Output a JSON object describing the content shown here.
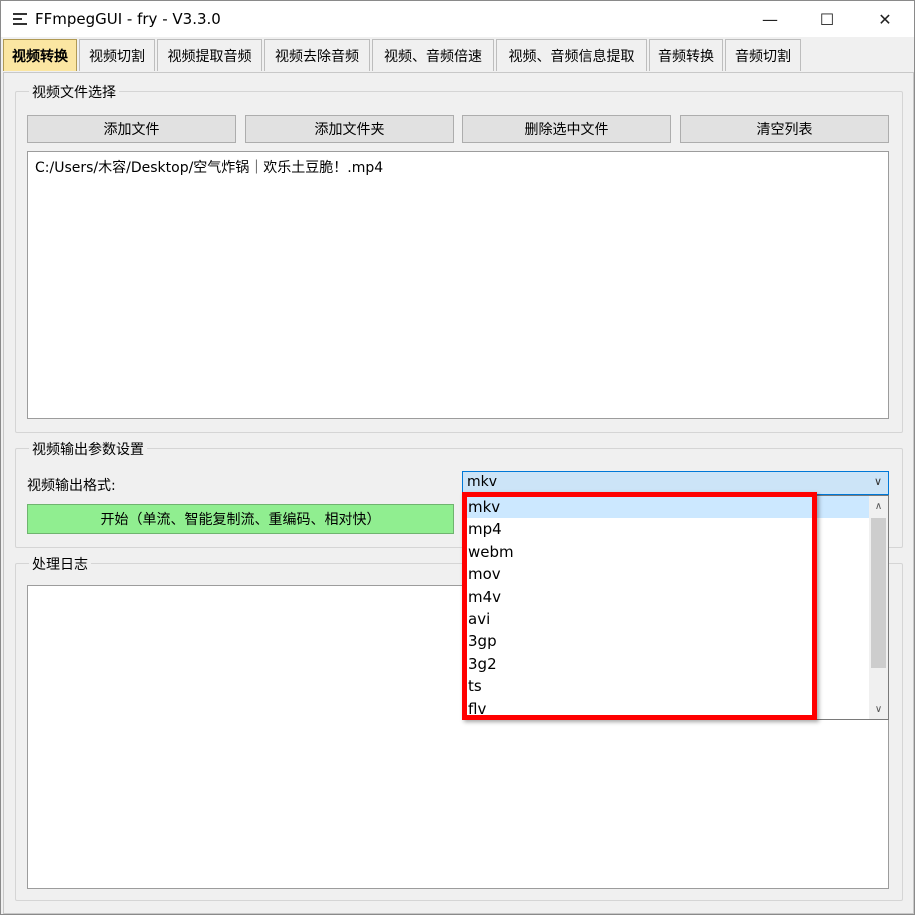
{
  "window": {
    "title": "FFmpegGUI - fry - V3.3.0",
    "minimize_glyph": "—",
    "maximize_glyph": "☐",
    "close_glyph": "✕"
  },
  "tabs": [
    {
      "label": "视频转换",
      "active": true
    },
    {
      "label": "视频切割"
    },
    {
      "label": "视频提取音频"
    },
    {
      "label": "视频去除音频"
    },
    {
      "label": "视频、音频倍速"
    },
    {
      "label": "视频、音频信息提取"
    },
    {
      "label": "音频转换"
    },
    {
      "label": "音频切割"
    }
  ],
  "file_group": {
    "title": "视频文件选择",
    "buttons": {
      "add_file": "添加文件",
      "add_folder": "添加文件夹",
      "delete_selected": "删除选中文件",
      "clear_list": "清空列表"
    },
    "files": [
      "C:/Users/木容/Desktop/空气炸锅｜欢乐土豆脆！.mp4"
    ]
  },
  "output_group": {
    "title": "视频输出参数设置",
    "format_label": "视频输出格式:",
    "format_value": "mkv",
    "start_button": "开始（单流、智能复制流、重编码、相对快）",
    "format_options": [
      "mkv",
      "mp4",
      "webm",
      "mov",
      "m4v",
      "avi",
      "3gp",
      "3g2",
      "ts",
      "flv"
    ]
  },
  "log_group": {
    "title": "处理日志"
  },
  "colors": {
    "active_tab": "#fbe6a2",
    "start_button": "#90ee90",
    "highlight": "#ff0000",
    "selected_item": "#cce8ff"
  }
}
